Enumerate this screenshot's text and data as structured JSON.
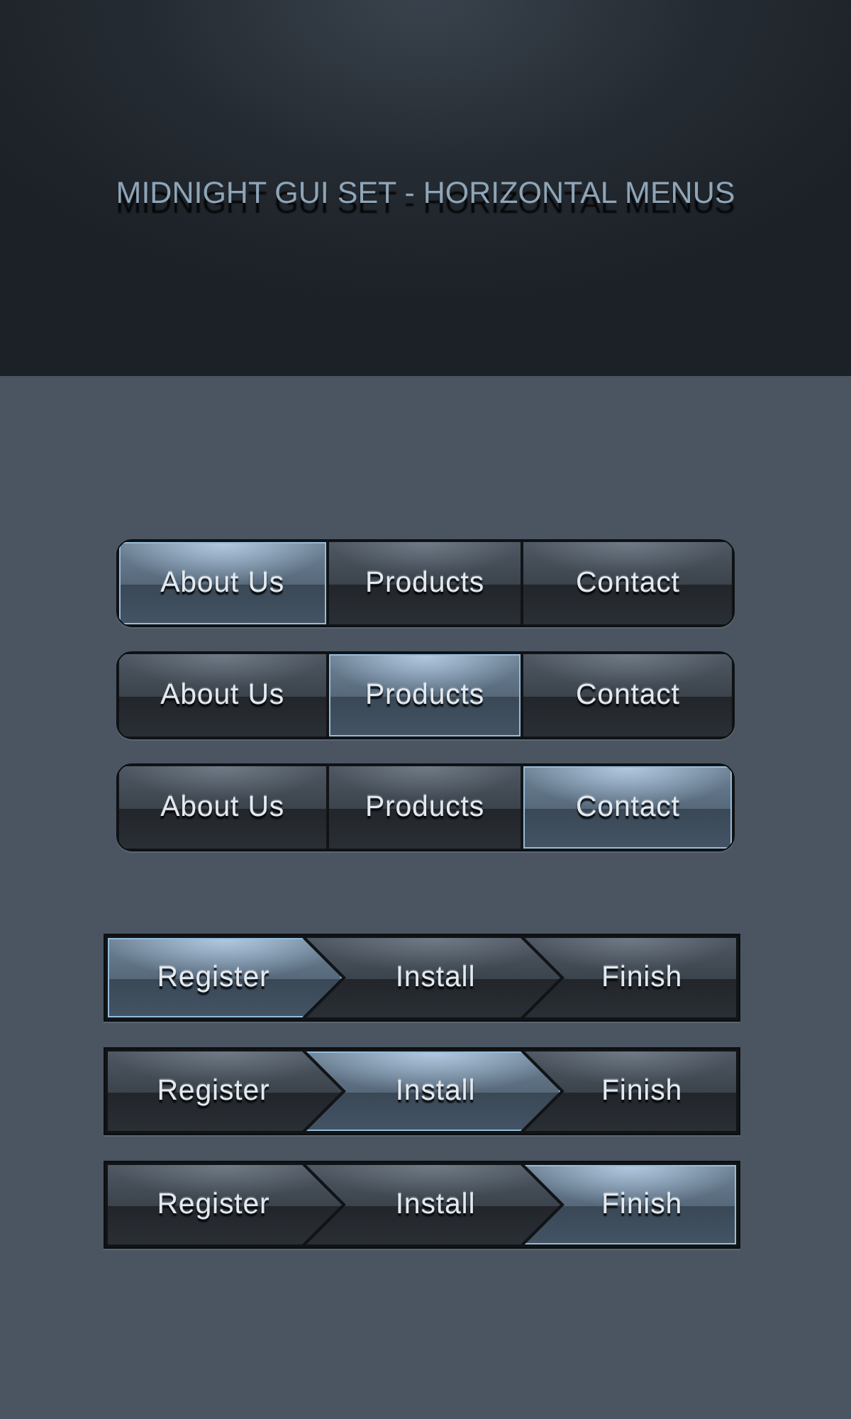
{
  "title": "MIDNIGHT GUI SET - HORIZONTAL MENUS",
  "tab_menus": [
    {
      "items": [
        {
          "label": "About Us",
          "selected": true
        },
        {
          "label": "Products",
          "selected": false
        },
        {
          "label": "Contact",
          "selected": false
        }
      ]
    },
    {
      "items": [
        {
          "label": "About Us",
          "selected": false
        },
        {
          "label": "Products",
          "selected": true
        },
        {
          "label": "Contact",
          "selected": false
        }
      ]
    },
    {
      "items": [
        {
          "label": "About Us",
          "selected": false
        },
        {
          "label": "Products",
          "selected": false
        },
        {
          "label": "Contact",
          "selected": true
        }
      ]
    }
  ],
  "step_menus": [
    {
      "steps": [
        {
          "label": "Register",
          "selected": true
        },
        {
          "label": "Install",
          "selected": false
        },
        {
          "label": "Finish",
          "selected": false
        }
      ]
    },
    {
      "steps": [
        {
          "label": "Register",
          "selected": false
        },
        {
          "label": "Install",
          "selected": true
        },
        {
          "label": "Finish",
          "selected": false
        }
      ]
    },
    {
      "steps": [
        {
          "label": "Register",
          "selected": false
        },
        {
          "label": "Install",
          "selected": false
        },
        {
          "label": "Finish",
          "selected": true
        }
      ]
    }
  ]
}
